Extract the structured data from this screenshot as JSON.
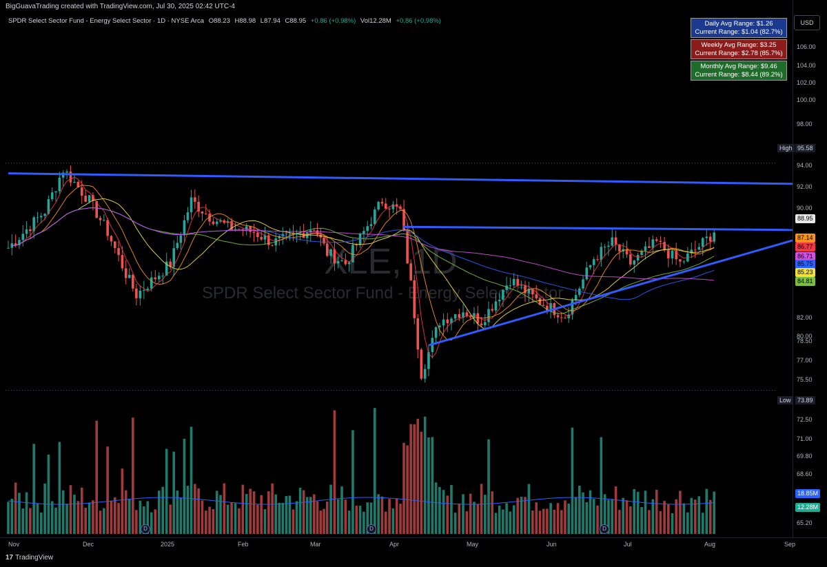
{
  "header": {
    "credit": "BigGuavaTrading created with TradingView.com, Jul 30, 2025 02:42 UTC-4"
  },
  "symbol_info": {
    "name": "SPDR Select Sector Fund - Energy Select Sector · 1D · NYSE Arca",
    "open": "O88.23",
    "high": "H88.98",
    "low": "L87.94",
    "close": "C88.95",
    "change": "+0.86 (+0.98%)",
    "volume": "Vol12.28M",
    "volume_change": "+0.86 (+0.98%)"
  },
  "currency": "USD",
  "range_boxes": [
    {
      "line1": "Daily Avg Range: $1.26",
      "line2": "Current Range: $1.04 (82.7%)",
      "color": "#1b3a8f"
    },
    {
      "line1": "Weekly Avg Range: $3.25",
      "line2": "Current Range: $2.78 (85.7%)",
      "color": "#8b1c1c"
    },
    {
      "line1": "Monthly Avg Range: $9.46",
      "line2": "Current Range: $8.44 (89.2%)",
      "color": "#1e6b2a"
    }
  ],
  "watermark": {
    "title": "XLE, 1D",
    "subtitle": "SPDR Select Sector Fund - Energy Select Sector"
  },
  "price_ticks": [
    "106.00",
    "104.00",
    "102.00",
    "100.00",
    "98.00",
    "94.00",
    "92.00",
    "90.00",
    "82.00",
    "80.00",
    "78.50",
    "77.00",
    "75.50",
    "72.50",
    "71.00",
    "69.80",
    "68.60",
    "65.20"
  ],
  "high_marker": {
    "label": "High",
    "value": "95.58"
  },
  "low_marker": {
    "label": "Low",
    "value": "73.89"
  },
  "price_pills": [
    {
      "value": "88.95",
      "color": "#e8e8e8"
    },
    {
      "value": "87.14",
      "color": "#f7931a"
    },
    {
      "value": "86.77",
      "color": "#f23645"
    },
    {
      "value": "86.71",
      "color": "#d050e0"
    },
    {
      "value": "85.75",
      "color": "#2962ff"
    },
    {
      "value": "85.23",
      "color": "#f0e040"
    },
    {
      "value": "84.81",
      "color": "#7cc040"
    }
  ],
  "volume_pills": [
    {
      "value": "18.85M",
      "color": "#2962ff"
    },
    {
      "value": "12.28M",
      "color": "#22ab94"
    }
  ],
  "month_labels": [
    "Nov",
    "Dec",
    "2025",
    "Feb",
    "Mar",
    "Apr",
    "May",
    "Jun",
    "Jul",
    "Aug",
    "Sep"
  ],
  "branding": "TradingView",
  "chart_data": {
    "type": "candlestick",
    "symbol": "XLE",
    "timeframe": "1D",
    "ylim": [
      73.0,
      108.0
    ],
    "x": [
      "2024-11-01",
      "2024-11-15",
      "2024-11-22",
      "2024-12-02",
      "2024-12-09",
      "2024-12-16",
      "2024-12-20",
      "2025-01-02",
      "2025-01-10",
      "2025-01-17",
      "2025-01-24",
      "2025-02-03",
      "2025-02-10",
      "2025-02-18",
      "2025-02-26",
      "2025-03-03",
      "2025-03-10",
      "2025-03-17",
      "2025-03-24",
      "2025-03-31",
      "2025-04-04",
      "2025-04-08",
      "2025-04-15",
      "2025-04-24",
      "2025-05-01",
      "2025-05-12",
      "2025-05-22",
      "2025-06-02",
      "2025-06-13",
      "2025-06-20",
      "2025-06-27",
      "2025-07-07",
      "2025-07-16",
      "2025-07-29"
    ],
    "close": [
      87.5,
      91.0,
      95.0,
      92.0,
      89.0,
      85.0,
      83.0,
      86.0,
      92.0,
      90.5,
      89.5,
      89.0,
      88.0,
      88.5,
      89.5,
      87.0,
      86.0,
      89.0,
      92.0,
      91.0,
      84.0,
      75.5,
      80.5,
      81.5,
      80.5,
      84.5,
      82.5,
      81.0,
      86.5,
      88.0,
      86.0,
      88.0,
      86.0,
      88.95
    ],
    "annotations": {
      "period_high": 95.58,
      "period_low": 73.89,
      "last_close": 88.95,
      "moving_averages": [
        87.14,
        86.77,
        86.71,
        85.75,
        85.23,
        84.81
      ],
      "last_volume": "12.28M",
      "avg_volume": "18.85M"
    },
    "trendlines": [
      {
        "name": "upper resistance",
        "from": [
          "2024-11-01",
          94.6
        ],
        "to": [
          "2025-08-28",
          93.6
        ]
      },
      {
        "name": "horizontal resistance",
        "from": [
          "2025-04-01",
          89.5
        ],
        "to": [
          "2025-08-28",
          89.2
        ]
      },
      {
        "name": "rising support",
        "from": [
          "2025-04-11",
          78.2
        ],
        "to": [
          "2025-08-28",
          88.2
        ]
      }
    ]
  }
}
